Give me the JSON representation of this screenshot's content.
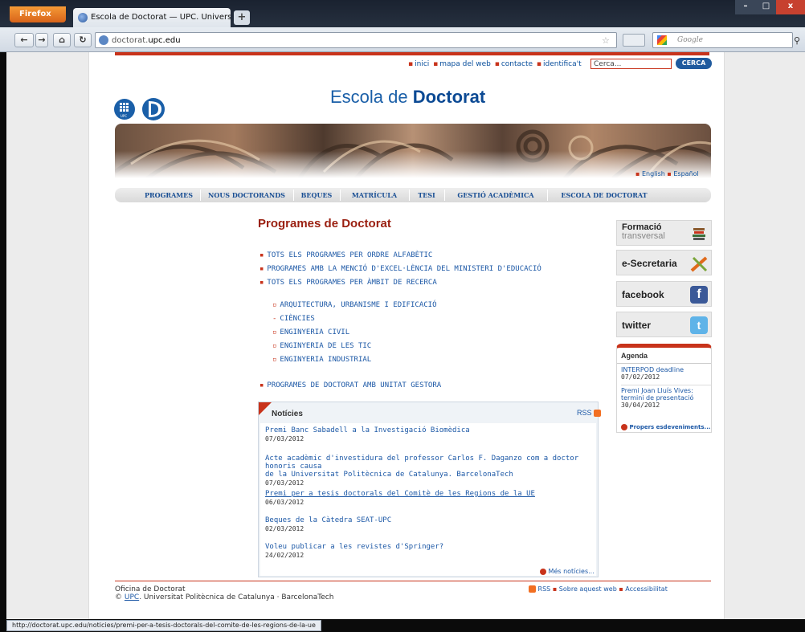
{
  "browser": {
    "app_button": "Firefox",
    "tab_title": "Escola de Doctorat — UPC. Universitat P...",
    "new_tab": "+",
    "url_prefix": "doctorat.",
    "url_domain": "upc.edu",
    "search_engine": "Google",
    "status_url": "http://doctorat.upc.edu/noticies/premi-per-a-tesis-doctorals-del-comite-de-les-regions-de-la-ue"
  },
  "header": {
    "links": [
      "inici",
      "mapa del web",
      "contacte",
      "identifica't"
    ],
    "search_placeholder": "Cerca...",
    "search_button": "CERCA",
    "title_prefix": "Escola de ",
    "title_bold": "Doctorat",
    "languages": [
      "English",
      "Español"
    ]
  },
  "nav": [
    "PROGRAMES",
    "NOUS DOCTORANDS",
    "BEQUES",
    "MATRÍCULA",
    "TESI",
    "GESTIÓ ACADÈMICA",
    "ESCOLA DE DOCTORAT"
  ],
  "main": {
    "heading": "Programes de Doctorat",
    "programs": [
      "TOTS ELS PROGRAMES PER ORDRE ALFABÈTIC",
      "PROGRAMES AMB LA MENCIÓ D'EXCEL·LÈNCIA DEL MINISTERI D'EDUCACIÓ",
      "TOTS ELS PROGRAMES PER ÀMBIT DE RECERCA"
    ],
    "areas": [
      "ARQUITECTURA, URBANISME I EDIFICACIÓ",
      "CIÈNCIES",
      "ENGINYERIA CIVIL",
      "ENGINYERIA DE LES TIC",
      "ENGINYERIA INDUSTRIAL"
    ],
    "unit_programs": "PROGRAMES DE DOCTORAT AMB UNITAT GESTORA"
  },
  "news": {
    "title": "Notícies",
    "rss": "RSS",
    "more": "Més notícies...",
    "items": [
      {
        "title": "Premi Banc Sabadell a la Investigació Biomèdica",
        "date": "07/03/2012"
      },
      {
        "title": "Acte acadèmic d'investidura del professor Carlos F. Daganzo com a doctor honoris causa",
        "title2": "de la Universitat Politècnica de Catalunya. BarcelonaTech",
        "date": "07/03/2012"
      },
      {
        "title": "Premi per a tesis doctorals del Comitè de les Regions de la UE",
        "date": "06/03/2012"
      },
      {
        "title": "Beques de la Càtedra SEAT-UPC",
        "date": "02/03/2012"
      },
      {
        "title": "Voleu publicar a les revistes d'Springer?",
        "date": "24/02/2012"
      }
    ]
  },
  "sidebar": {
    "formacio_1": "Formació",
    "formacio_2": "transversal",
    "esecretaria": "e-Secretaria",
    "facebook": "facebook",
    "facebook_icon": "f",
    "twitter": "twitter",
    "twitter_icon": "t"
  },
  "agenda": {
    "title": "Agenda",
    "items": [
      {
        "title": "INTERPOD deadline",
        "date": "07/02/2012"
      },
      {
        "title": "Premi Joan Lluís Vives:",
        "title2": "termini de presentació",
        "date": "30/04/2012"
      }
    ],
    "more": "Propers esdeveniments..."
  },
  "footer": {
    "line1": "Oficina de Doctorat",
    "copyright": "©",
    "upc": "UPC",
    "line2_rest": ". Universitat Politècnica de Catalunya · BarcelonaTech",
    "links": [
      "RSS",
      "Sobre aquest web",
      "Accessibilitat"
    ]
  },
  "colors": {
    "accent": "#c8331b",
    "link": "#1c58a6",
    "title": "#1a5fa8"
  }
}
